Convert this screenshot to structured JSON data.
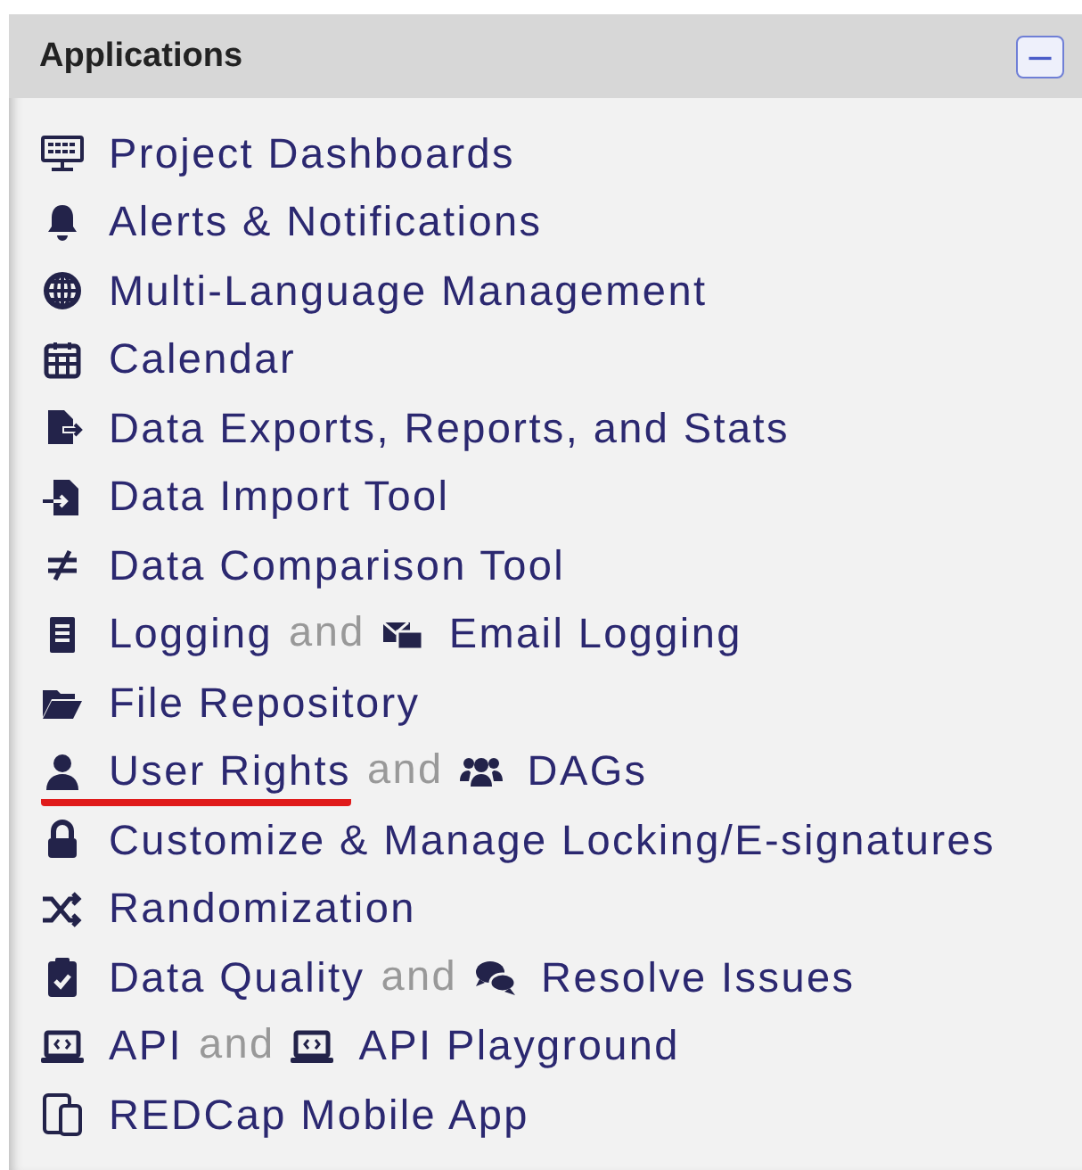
{
  "panel": {
    "title": "Applications",
    "collapse_button": "−"
  },
  "items": [
    {
      "parts": [
        {
          "kind": "link",
          "text": "Project Dashboards",
          "marked": false
        }
      ]
    },
    {
      "parts": [
        {
          "kind": "link",
          "text": "Alerts & Notifications",
          "marked": false
        }
      ]
    },
    {
      "parts": [
        {
          "kind": "link",
          "text": "Multi-Language Management",
          "marked": false
        }
      ]
    },
    {
      "parts": [
        {
          "kind": "link",
          "text": "Calendar",
          "marked": false
        }
      ]
    },
    {
      "parts": [
        {
          "kind": "link",
          "text": "Data Exports, Reports, and Stats",
          "marked": false
        }
      ]
    },
    {
      "parts": [
        {
          "kind": "link",
          "text": "Data Import Tool",
          "marked": false
        }
      ]
    },
    {
      "parts": [
        {
          "kind": "link",
          "text": "Data Comparison Tool",
          "marked": false
        }
      ]
    },
    {
      "parts": [
        {
          "kind": "link",
          "text": "Logging",
          "marked": false
        },
        {
          "kind": "sep",
          "text": "and"
        },
        {
          "kind": "link",
          "text": "Email Logging",
          "marked": false
        }
      ]
    },
    {
      "parts": [
        {
          "kind": "link",
          "text": "File Repository",
          "marked": false
        }
      ]
    },
    {
      "parts": [
        {
          "kind": "link",
          "text": "User Rights",
          "marked": true
        },
        {
          "kind": "sep",
          "text": "and"
        },
        {
          "kind": "link",
          "text": "DAGs",
          "marked": false
        }
      ]
    },
    {
      "parts": [
        {
          "kind": "link",
          "text": "Customize & Manage Locking/E-signatures",
          "marked": false
        }
      ]
    },
    {
      "parts": [
        {
          "kind": "link",
          "text": "Randomization",
          "marked": false
        }
      ]
    },
    {
      "parts": [
        {
          "kind": "link",
          "text": "Data Quality",
          "marked": false
        },
        {
          "kind": "sep",
          "text": "and"
        },
        {
          "kind": "link",
          "text": "Resolve Issues",
          "marked": false
        }
      ]
    },
    {
      "parts": [
        {
          "kind": "link",
          "text": "API",
          "marked": false
        },
        {
          "kind": "sep",
          "text": "and"
        },
        {
          "kind": "link",
          "text": "API Playground",
          "marked": false
        }
      ]
    },
    {
      "parts": [
        {
          "kind": "link",
          "text": "REDCap Mobile App",
          "marked": false
        }
      ]
    }
  ]
}
